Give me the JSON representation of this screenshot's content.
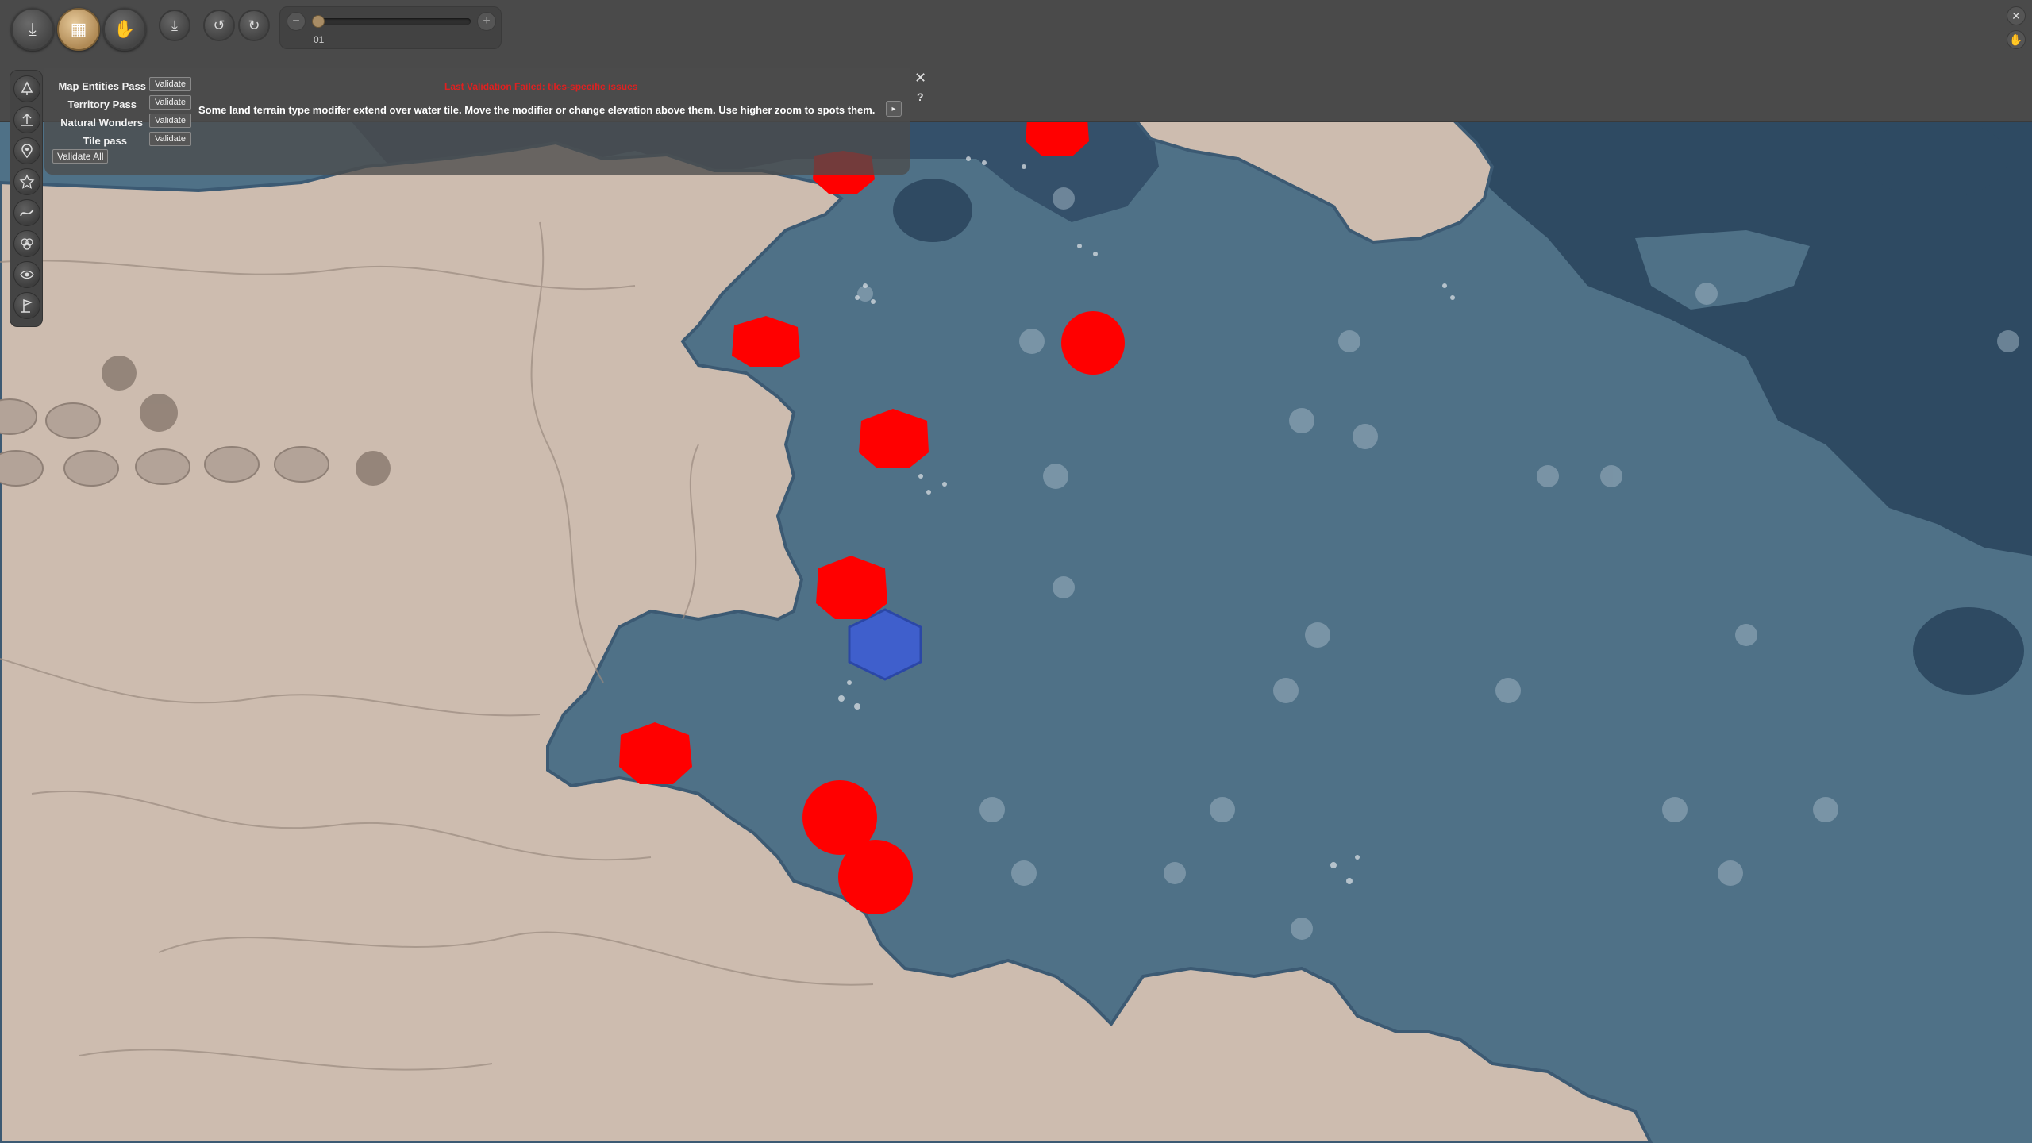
{
  "toolbar": {
    "zoom_value": "01",
    "zoom_level": 0.0,
    "minus_label": "−",
    "plus_label": "+",
    "close_label": "✕"
  },
  "validation": {
    "passes": [
      {
        "label": "Map Entities Pass",
        "button": "Validate"
      },
      {
        "label": "Territory Pass",
        "button": "Validate"
      },
      {
        "label": "Natural Wonders",
        "button": "Validate"
      },
      {
        "label": "Tile pass",
        "button": "Validate"
      }
    ],
    "validate_all": "Validate All",
    "error_title": "Last Validation Failed: tiles-specific issues",
    "error_message": "Some land terrain type modifer extend over water tile. Move the modifier or change elevation above them. Use higher zoom to spots them.",
    "close_label": "✕",
    "help_label": "?",
    "next_label": "▸"
  },
  "colors": {
    "land": "#cdbcaf",
    "shallow_water": "#4f7187",
    "deep_water": "#2e4a62",
    "error_marker": "#ff0000",
    "selected_tile": "#3f5fd0",
    "toolbar": "#4a4a4a",
    "active_tool": "#c6a36d"
  },
  "icons": {
    "toolbar": [
      "import-icon",
      "terrain-brush-icon",
      "hand-pan-icon",
      "save-icon",
      "undo-icon",
      "redo-icon"
    ],
    "sidebar": [
      "tree-icon",
      "elevation-icon",
      "location-pin-icon",
      "star-icon",
      "river-icon",
      "resource-icon",
      "visibility-eye-icon",
      "flag-icon"
    ]
  }
}
